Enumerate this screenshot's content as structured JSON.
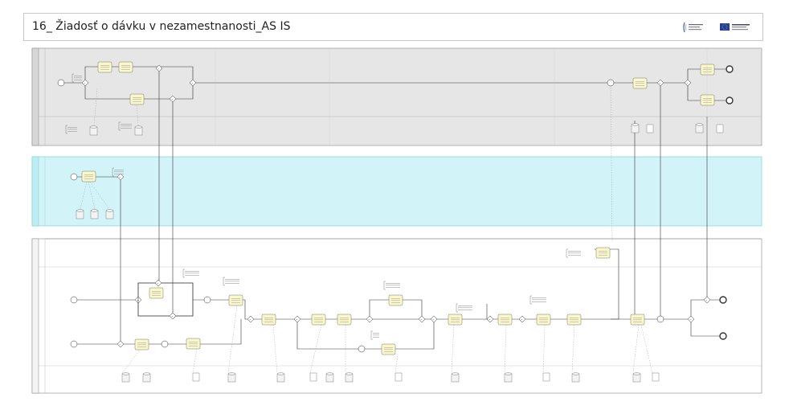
{
  "header": {
    "title": "16_ Žiadosť o dávku v nezamestnanosti_AS IS",
    "logos": [
      "ministry-logo-icon",
      "eu-flag-icon"
    ]
  },
  "pools": [
    {
      "name": "pool-top",
      "color": "#e8e8e8"
    },
    {
      "name": "pool-middle",
      "color": "#c9f2f7"
    },
    {
      "name": "pool-bottom",
      "color": "#ffffff"
    }
  ],
  "colors": {
    "task": "#fbf7c9",
    "stroke": "#555555"
  }
}
